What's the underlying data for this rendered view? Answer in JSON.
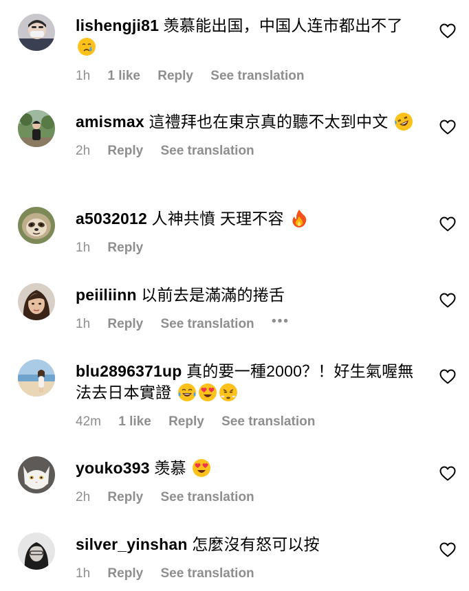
{
  "comments": [
    {
      "username": "lishengji81",
      "text": "羡慕能出国，中国人连市都出不了",
      "emojis": [
        "crying-face"
      ],
      "time": "1h",
      "likes": "1 like",
      "reply": "Reply",
      "translate": "See translation",
      "avatar": "avatar-masked-person"
    },
    {
      "username": "amismax",
      "text": "這禮拜也在東京真的聽不太到中文",
      "emojis": [
        "rolling-laughing-face"
      ],
      "time": "2h",
      "reply": "Reply",
      "translate": "See translation",
      "avatar": "avatar-person-outdoors"
    },
    {
      "username": "a5032012",
      "text": "人神共憤 天理不容",
      "emojis": [
        "fire"
      ],
      "time": "1h",
      "reply": "Reply",
      "avatar": "avatar-sloth"
    },
    {
      "username": "peiiliinn",
      "text": "以前去是滿滿的捲舌",
      "emojis": [],
      "time": "1h",
      "reply": "Reply",
      "translate": "See translation",
      "more": "•••",
      "avatar": "avatar-woman-portrait"
    },
    {
      "username": "blu2896371up",
      "text": "真的要一種2000？！好生氣喔無法去日本實證",
      "emojis": [
        "tears-of-joy-face",
        "heart-eyes-face",
        "steam-nose-face"
      ],
      "time": "42m",
      "likes": "1 like",
      "reply": "Reply",
      "translate": "See translation",
      "avatar": "avatar-beach-person"
    },
    {
      "username": "youko393",
      "text": "羡慕",
      "emojis": [
        "heart-eyes-face"
      ],
      "time": "2h",
      "reply": "Reply",
      "translate": "See translation",
      "avatar": "avatar-white-cat"
    },
    {
      "username": "silver_yinshan",
      "text": "怎麼沒有怒可以按",
      "emojis": [],
      "time": "1h",
      "reply": "Reply",
      "translate": "See translation",
      "avatar": "avatar-dark-hair-person"
    }
  ],
  "icons": {
    "like": "heart-outline-icon"
  }
}
